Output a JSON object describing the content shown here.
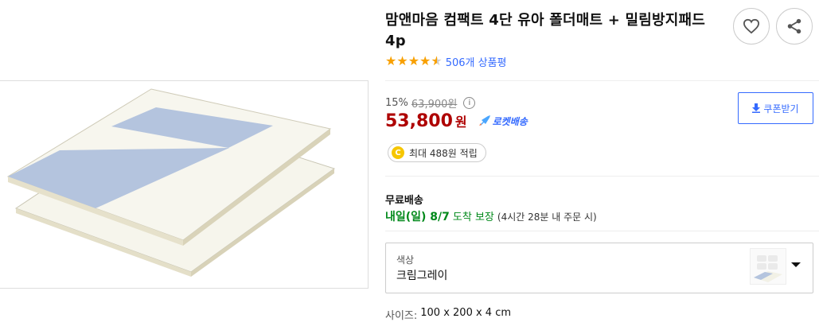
{
  "product": {
    "title": "맘앤마음 컴팩트 4단 유아 폴더매트 + 밀림방지패드 4p",
    "rating": 4.5,
    "review_count": "506개 상품평"
  },
  "price": {
    "discount_rate": "15%",
    "original_price": "63,900원",
    "sale_price": "53,800",
    "currency_unit": "원",
    "delivery_badge": "로켓배송"
  },
  "coupon": {
    "label": "쿠폰받기"
  },
  "cash": {
    "icon_letter": "C",
    "label": "최대 488원 적립"
  },
  "shipping": {
    "label": "무료배송",
    "arrival_date": "내일(일) 8/7",
    "arrival_text": "도착 보장",
    "arrival_note": "(4시간 28분 내 주문 시)"
  },
  "option": {
    "label": "색상",
    "value": "크림그레이"
  },
  "size": {
    "label": "사이즈:",
    "value": "100 x 200 x 4 cm"
  },
  "icons": {
    "wish": "heart-icon",
    "share": "share-icon",
    "info": "info-icon",
    "coupon": "download-icon",
    "rocket": "rocket-icon",
    "dropdown": "chevron-down-icon"
  },
  "colors": {
    "price_red": "#ae0000",
    "link_blue": "#346aff",
    "star_orange": "#f8a000",
    "arrival_green": "#00891a",
    "mat_cream": "#f3f3e8",
    "mat_blue": "#aebfdb"
  }
}
